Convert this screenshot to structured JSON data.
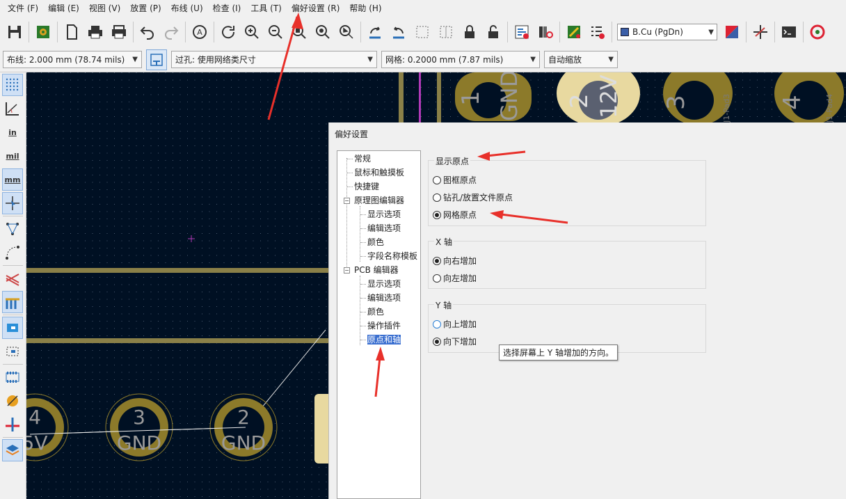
{
  "menubar": {
    "items": [
      "文件 (F)",
      "编辑 (E)",
      "视图 (V)",
      "放置 (P)",
      "布线 (U)",
      "检查 (I)",
      "工具 (T)",
      "偏好设置 (R)",
      "帮助 (H)"
    ]
  },
  "toolbar": {
    "layer_select": "B.Cu (PgDn)",
    "layer_color": "#3b5fa8"
  },
  "optbar": {
    "track_width": "布线: 2.000 mm (78.74 mils)",
    "via_size": "过孔: 使用网络类尺寸",
    "grid": "网格: 0.2000 mm (7.87 mils)",
    "zoom": "自动缩放"
  },
  "lefttoolbar": {
    "in_label": "in",
    "mil_label": "mil",
    "mm_label": "mm"
  },
  "canvas": {
    "pads_top": [
      "1",
      "2",
      "3",
      "4"
    ],
    "pad_top_nets": [
      "GND",
      "12V",
      "",
      ""
    ],
    "pad_top_refs": [
      "J1-Pad3",
      "J1-Pad4"
    ],
    "pads_bottom": [
      "4",
      "3",
      "2"
    ],
    "pad_bottom_nets": [
      "5V",
      "GND",
      "GND"
    ],
    "colors": {
      "background": "#001023",
      "pad": "#8c7a2a",
      "pad_highlight": "#e8d9a0",
      "track": "#8a8048"
    }
  },
  "dialog": {
    "title": "偏好设置",
    "tree": {
      "items": [
        {
          "label": "常规",
          "level": 0
        },
        {
          "label": "鼠标和触摸板",
          "level": 0
        },
        {
          "label": "快捷键",
          "level": 0
        },
        {
          "label": "原理图编辑器",
          "level": 0
        },
        {
          "label": "显示选项",
          "level": 1
        },
        {
          "label": "编辑选项",
          "level": 1
        },
        {
          "label": "颜色",
          "level": 1
        },
        {
          "label": "字段名称模板",
          "level": 1
        },
        {
          "label": "PCB 编辑器",
          "level": 0
        },
        {
          "label": "显示选项",
          "level": 1
        },
        {
          "label": "编辑选项",
          "level": 1
        },
        {
          "label": "颜色",
          "level": 1
        },
        {
          "label": "操作插件",
          "level": 1
        },
        {
          "label": "原点和轴",
          "level": 1
        }
      ],
      "selected": "原点和轴"
    },
    "origin_group": {
      "title": "显示原点",
      "options": [
        "图框原点",
        "钻孔/放置文件原点",
        "网格原点"
      ],
      "selected": "网格原点"
    },
    "x_axis_group": {
      "title": "X 轴",
      "options": [
        "向右增加",
        "向左增加"
      ],
      "selected": "向右增加"
    },
    "y_axis_group": {
      "title": "Y 轴",
      "options": [
        "向上增加",
        "向下增加"
      ],
      "selected": "向下增加"
    },
    "tooltip": "选择屏幕上 Y 轴增加的方向。"
  },
  "annotations": {
    "arrow_color": "#e8302a"
  }
}
